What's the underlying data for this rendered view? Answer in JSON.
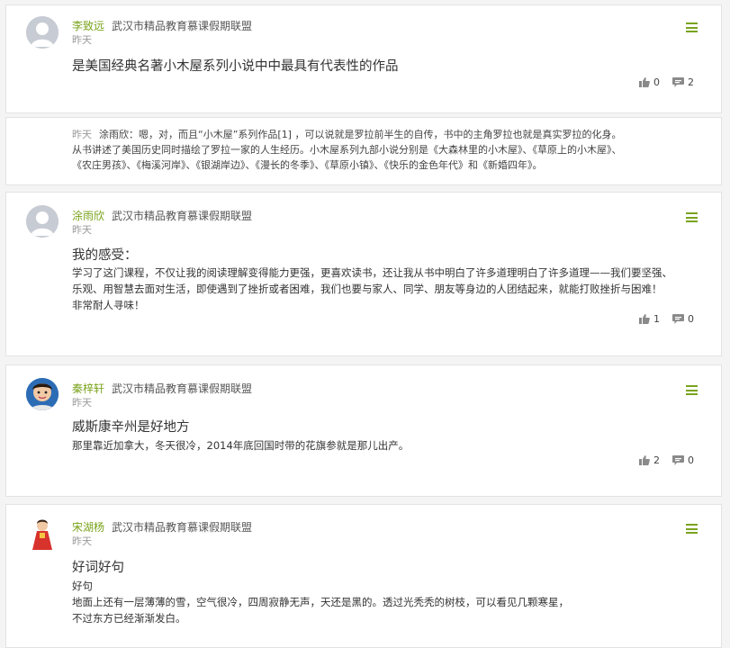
{
  "posts": [
    {
      "user": "李致远",
      "group": "武汉市精品教育慕课假期联盟",
      "time": "昨天",
      "title": "是美国经典名著小木屋系列小说中中最具有代表性的作品",
      "body": [],
      "likes": "0",
      "comments": "2",
      "avatar": "default"
    },
    {
      "user": "涂雨欣",
      "group": "武汉市精品教育慕课假期联盟",
      "time": "昨天",
      "title": "我的感受：",
      "body": [
        "学习了这门课程，不仅让我的阅读理解变得能力更强，更喜欢读书，还让我从书中明白了许多道理明白了许多道理——我们要坚强、",
        "乐观、用智慧去面对生活，即使遇到了挫折或者困难，我们也要与家人、同学、朋友等身边的人团结起来，就能打败挫折与困难！",
        "非常耐人寻味！"
      ],
      "likes": "1",
      "comments": "0",
      "avatar": "default"
    },
    {
      "user": "秦梓轩",
      "group": "武汉市精品教育慕课假期联盟",
      "time": "昨天",
      "title": "威斯康辛州是好地方",
      "body": [
        "那里靠近加拿大，冬天很冷，2014年底回国时带的花旗参就是那儿出产。"
      ],
      "likes": "2",
      "comments": "0",
      "avatar": "boy"
    },
    {
      "user": "宋湖杨",
      "group": "武汉市精品教育慕课假期联盟",
      "time": "昨天",
      "title": "好词好句",
      "body": [
        "好句",
        "地面上还有一层薄薄的雪，空气很冷，四周寂静无声，天还是黑的。透过光秃秃的树枝，可以看见几颗寒星，",
        "不过东方已经渐渐发白。"
      ],
      "avatar": "girl"
    }
  ],
  "reply": {
    "time": "昨天",
    "user": "涂雨欣",
    "lines": [
      "：嗯，对，而且“小木屋”系列作品[1] ，可以说就是罗拉前半生的自传，书中的主角罗拉也就是真实罗拉的化身。",
      "从书讲述了美国历史同时描绘了罗拉一家的人生经历。小木屋系列九部小说分别是《大森林里的小木屋》、《草原上的小木屋》、",
      "《农庄男孩》、《梅溪河岸》、《银湖岸边》、《漫长的冬季》、《草原小镇》、《快乐的金色年代》和《新婚四年》。"
    ]
  },
  "colors": {
    "accent": "#7aa31c",
    "icon_gray": "#8a8a8a"
  }
}
